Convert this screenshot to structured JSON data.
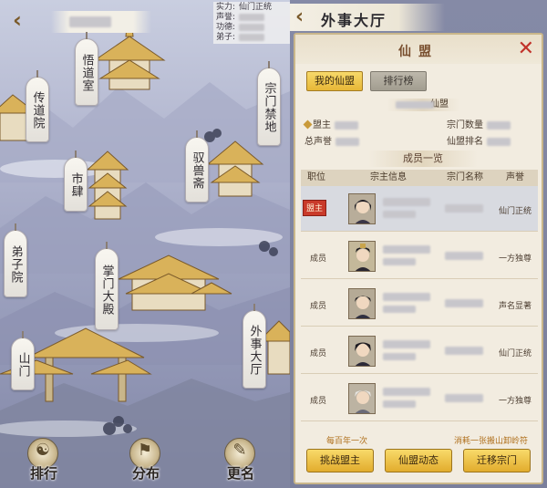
{
  "map": {
    "stats": [
      {
        "label": "实力:",
        "value": "仙门正统"
      },
      {
        "label": "声誉:",
        "value": ""
      },
      {
        "label": "功德:",
        "value": ""
      },
      {
        "label": "弟子:",
        "value": ""
      }
    ],
    "buildings": [
      {
        "key": "wudao",
        "label": "悟道室"
      },
      {
        "key": "chuandao",
        "label": "传道院"
      },
      {
        "key": "zongmen",
        "label": "宗门禁地"
      },
      {
        "key": "yushou",
        "label": "驭兽斋"
      },
      {
        "key": "shisi",
        "label": "市肆"
      },
      {
        "key": "dizi",
        "label": "弟子院"
      },
      {
        "key": "zhangmen",
        "label": "掌门大殿"
      },
      {
        "key": "waishi",
        "label": "外事大厅"
      },
      {
        "key": "shanmen",
        "label": "山门"
      }
    ],
    "bottom_buttons": [
      {
        "key": "rank",
        "label": "排行",
        "icon": "scroll-icon"
      },
      {
        "key": "layout",
        "label": "分布",
        "icon": "map-flag-icon"
      },
      {
        "key": "rename",
        "label": "更名",
        "icon": "brush-icon"
      }
    ]
  },
  "hall": {
    "title": "外事大厅",
    "panel_title": "仙盟",
    "tabs": {
      "mine": "我的仙盟",
      "ranking": "排行榜"
    },
    "alliance_name_suffix": "仙盟",
    "info": {
      "leader": "盟主",
      "total_fame": "总声誉",
      "sect_count": "宗门数量",
      "alliance_rank": "仙盟排名"
    },
    "members_title": "成员一览",
    "columns": [
      "职位",
      "宗主信息",
      "宗门名称",
      "声誉"
    ],
    "members": [
      {
        "role": "盟主",
        "fame": "仙门正统",
        "leader": true
      },
      {
        "role": "成员",
        "fame": "一方独尊",
        "leader": false
      },
      {
        "role": "成员",
        "fame": "声名显著",
        "leader": false
      },
      {
        "role": "成员",
        "fame": "仙门正统",
        "leader": false
      },
      {
        "role": "成员",
        "fame": "一方独尊",
        "leader": false
      }
    ],
    "footer": {
      "left_note": "每百年一次",
      "right_note": "消耗一张搬山卸岭符",
      "buttons": [
        "挑战盟主",
        "仙盟动态",
        "迁移宗门"
      ]
    }
  },
  "colors": {
    "accent_gold": "#e7b737",
    "close_red": "#c1322a",
    "leader_red": "#c93a2a",
    "note_orange": "#b0701c"
  }
}
